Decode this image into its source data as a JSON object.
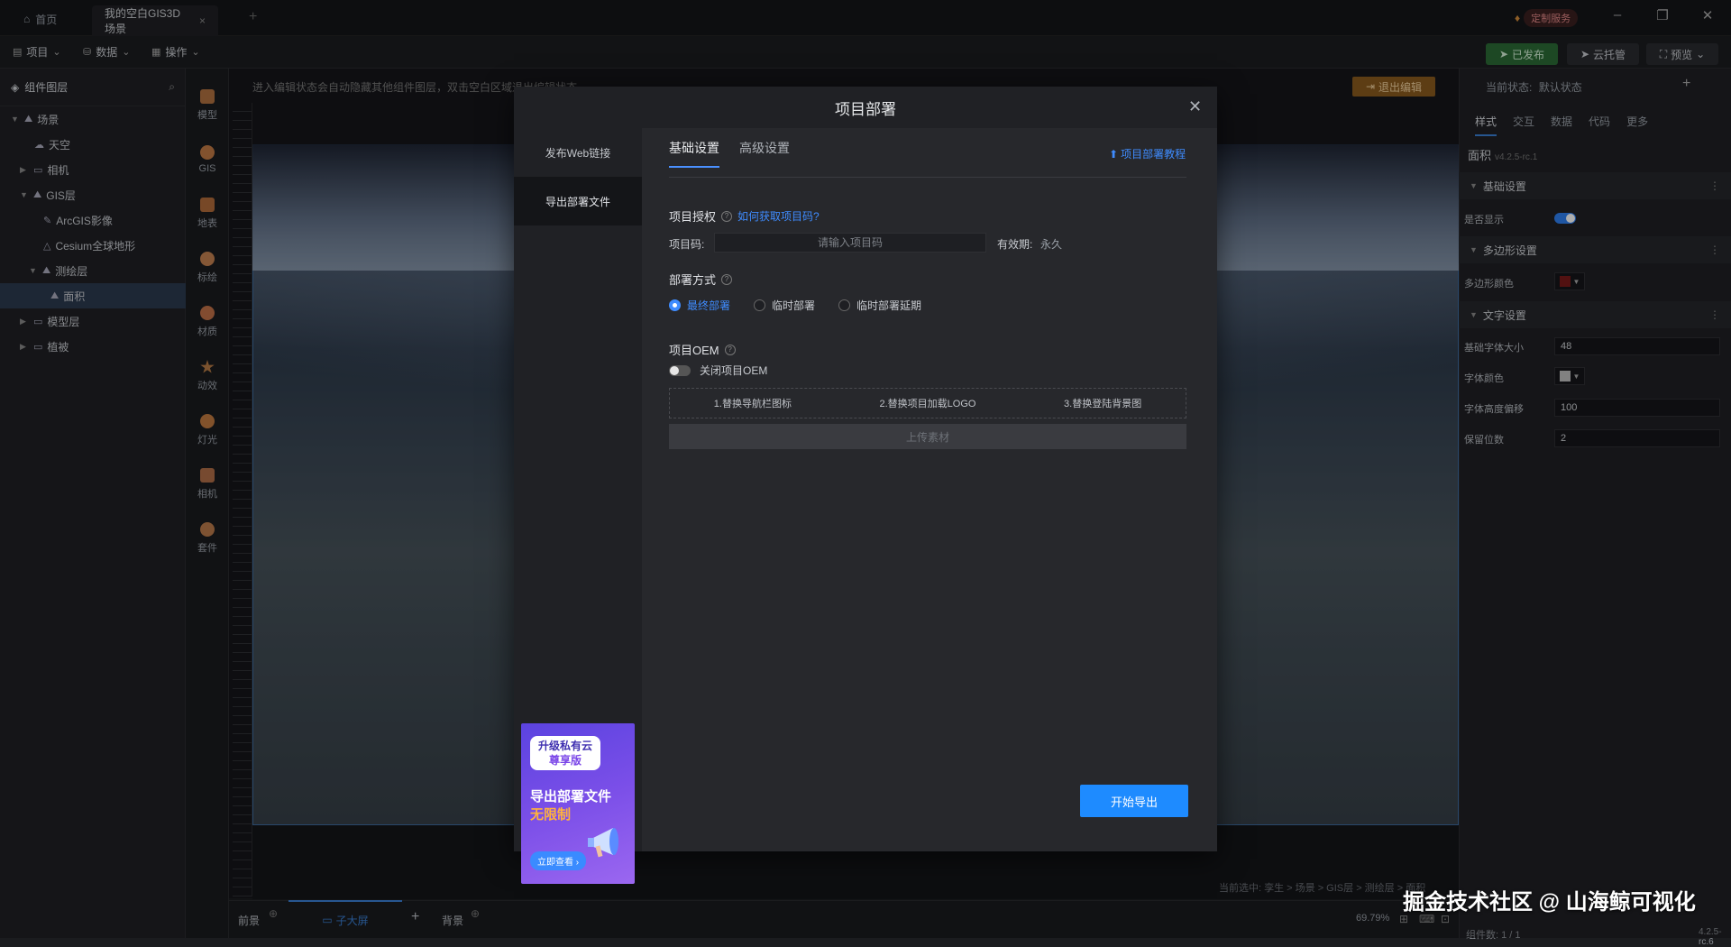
{
  "titlebar": {
    "home_label": "首页",
    "doc_tab": "我的空白GIS3D场景",
    "service_label": "定制服务"
  },
  "menubar": {
    "items": [
      "项目",
      "数据",
      "操作"
    ],
    "publish": "已发布",
    "cloud": "云托管",
    "preview": "预览"
  },
  "layer_panel": {
    "title": "组件图层",
    "tree": [
      {
        "label": "场景",
        "depth": 0
      },
      {
        "label": "天空",
        "depth": 1
      },
      {
        "label": "相机",
        "depth": 1
      },
      {
        "label": "GIS层",
        "depth": 1
      },
      {
        "label": "ArcGIS影像",
        "depth": 2
      },
      {
        "label": "Cesium全球地形",
        "depth": 2
      },
      {
        "label": "测绘层",
        "depth": 2
      },
      {
        "label": "面积",
        "depth": 3
      },
      {
        "label": "模型层",
        "depth": 1
      },
      {
        "label": "植被",
        "depth": 1
      }
    ]
  },
  "tools": [
    {
      "label": "模型",
      "color": "#b07040"
    },
    {
      "label": "GIS",
      "color": "#c07a45"
    },
    {
      "label": "地表",
      "color": "#b06a3a"
    },
    {
      "label": "标绘",
      "color": "#c38050"
    },
    {
      "label": "材质",
      "color": "#c07048"
    },
    {
      "label": "动效",
      "color": "#b57a45"
    },
    {
      "label": "灯光",
      "color": "#c07a40"
    },
    {
      "label": "相机",
      "color": "#b06e48"
    },
    {
      "label": "套件",
      "color": "#b87a4a"
    }
  ],
  "canvas": {
    "hint": "进入编辑状态会自动隐藏其他组件图层，双击空白区域退出编辑状态",
    "exit_edit": "退出编辑",
    "breadcrumb": "当前选中: 孪生 > 场景 > GIS层 > 测绘层 > 面积"
  },
  "bottombar": {
    "front": "前景",
    "active_tab": "子大屏",
    "background": "背景",
    "zoom": "69.79%"
  },
  "right_panel": {
    "state_label": "当前状态:",
    "state_value": "默认状态",
    "tabs": [
      "样式",
      "交互",
      "数据",
      "代码",
      "更多"
    ],
    "component_title": "面积",
    "component_version": "v4.2.5-rc.1",
    "sections": {
      "basic": "基础设置",
      "polygon": "多边形设置",
      "text": "文字设置"
    },
    "rows": {
      "visible": "是否显示",
      "polygon_color": "多边形颜色",
      "font_size_label": "基础字体大小",
      "font_size_value": "48",
      "font_color": "字体颜色",
      "height_offset_label": "字体高度偏移",
      "height_offset_value": "100",
      "decimals_label": "保留位数",
      "decimals_value": "2"
    },
    "footer_count": "组件数: 1 / 1",
    "footer_version": "4.2.5-rc.6",
    "colors": {
      "polygon": "#7a1a1a",
      "font": "#bfbfbf"
    }
  },
  "modal": {
    "title": "项目部署",
    "side": [
      "发布Web链接",
      "导出部署文件"
    ],
    "tabs": [
      "基础设置",
      "高级设置"
    ],
    "tutorial": "项目部署教程",
    "auth": {
      "label": "项目授权",
      "how_link": "如何获取项目码?",
      "code_label": "项目码:",
      "code_placeholder": "请输入项目码",
      "validity_label": "有效期:",
      "validity_value": "永久"
    },
    "deploy": {
      "label": "部署方式",
      "options": [
        "最终部署",
        "临时部署",
        "临时部署延期"
      ]
    },
    "oem": {
      "label": "项目OEM",
      "toggle_label": "关闭项目OEM",
      "steps": [
        "1.替换导航栏图标",
        "2.替换项目加载LOGO",
        "3.替换登陆背景图"
      ],
      "upload": "上传素材"
    },
    "export_button": "开始导出",
    "promo": {
      "line1": "升级私有云",
      "line2": "尊享版",
      "line3": "导出部署文件",
      "line4": "无限制",
      "cta": "立即查看"
    }
  },
  "watermark": "掘金技术社区 @ 山海鲸可视化"
}
